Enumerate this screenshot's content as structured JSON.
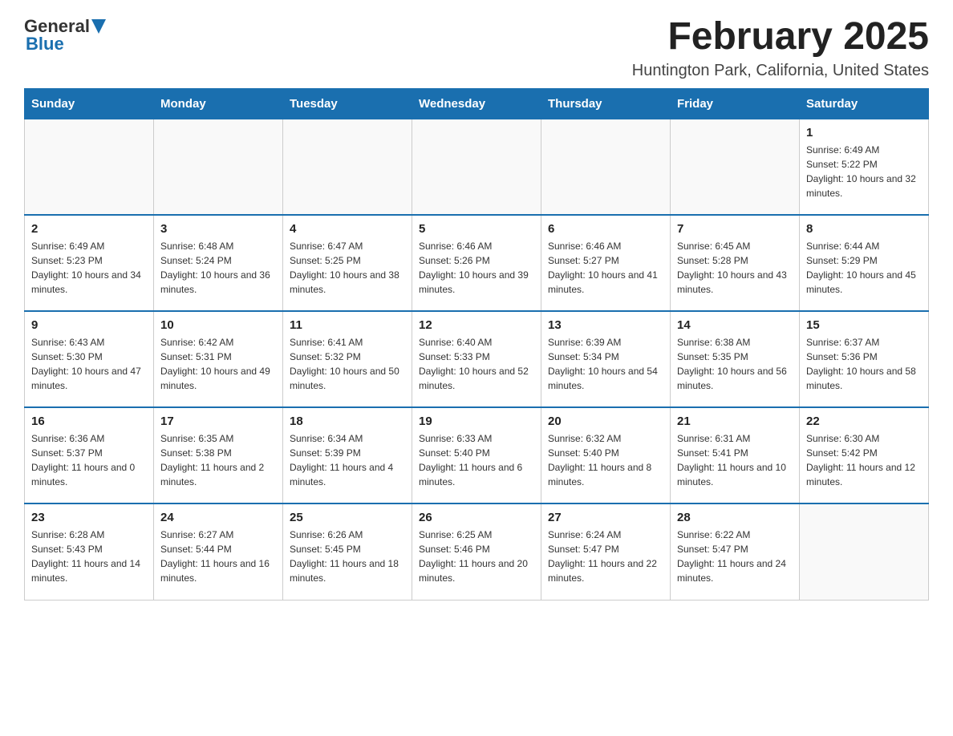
{
  "header": {
    "logo_general": "General",
    "logo_blue": "Blue",
    "month_title": "February 2025",
    "location": "Huntington Park, California, United States"
  },
  "days_of_week": [
    "Sunday",
    "Monday",
    "Tuesday",
    "Wednesday",
    "Thursday",
    "Friday",
    "Saturday"
  ],
  "weeks": [
    [
      {
        "day": "",
        "info": ""
      },
      {
        "day": "",
        "info": ""
      },
      {
        "day": "",
        "info": ""
      },
      {
        "day": "",
        "info": ""
      },
      {
        "day": "",
        "info": ""
      },
      {
        "day": "",
        "info": ""
      },
      {
        "day": "1",
        "info": "Sunrise: 6:49 AM\nSunset: 5:22 PM\nDaylight: 10 hours and 32 minutes."
      }
    ],
    [
      {
        "day": "2",
        "info": "Sunrise: 6:49 AM\nSunset: 5:23 PM\nDaylight: 10 hours and 34 minutes."
      },
      {
        "day": "3",
        "info": "Sunrise: 6:48 AM\nSunset: 5:24 PM\nDaylight: 10 hours and 36 minutes."
      },
      {
        "day": "4",
        "info": "Sunrise: 6:47 AM\nSunset: 5:25 PM\nDaylight: 10 hours and 38 minutes."
      },
      {
        "day": "5",
        "info": "Sunrise: 6:46 AM\nSunset: 5:26 PM\nDaylight: 10 hours and 39 minutes."
      },
      {
        "day": "6",
        "info": "Sunrise: 6:46 AM\nSunset: 5:27 PM\nDaylight: 10 hours and 41 minutes."
      },
      {
        "day": "7",
        "info": "Sunrise: 6:45 AM\nSunset: 5:28 PM\nDaylight: 10 hours and 43 minutes."
      },
      {
        "day": "8",
        "info": "Sunrise: 6:44 AM\nSunset: 5:29 PM\nDaylight: 10 hours and 45 minutes."
      }
    ],
    [
      {
        "day": "9",
        "info": "Sunrise: 6:43 AM\nSunset: 5:30 PM\nDaylight: 10 hours and 47 minutes."
      },
      {
        "day": "10",
        "info": "Sunrise: 6:42 AM\nSunset: 5:31 PM\nDaylight: 10 hours and 49 minutes."
      },
      {
        "day": "11",
        "info": "Sunrise: 6:41 AM\nSunset: 5:32 PM\nDaylight: 10 hours and 50 minutes."
      },
      {
        "day": "12",
        "info": "Sunrise: 6:40 AM\nSunset: 5:33 PM\nDaylight: 10 hours and 52 minutes."
      },
      {
        "day": "13",
        "info": "Sunrise: 6:39 AM\nSunset: 5:34 PM\nDaylight: 10 hours and 54 minutes."
      },
      {
        "day": "14",
        "info": "Sunrise: 6:38 AM\nSunset: 5:35 PM\nDaylight: 10 hours and 56 minutes."
      },
      {
        "day": "15",
        "info": "Sunrise: 6:37 AM\nSunset: 5:36 PM\nDaylight: 10 hours and 58 minutes."
      }
    ],
    [
      {
        "day": "16",
        "info": "Sunrise: 6:36 AM\nSunset: 5:37 PM\nDaylight: 11 hours and 0 minutes."
      },
      {
        "day": "17",
        "info": "Sunrise: 6:35 AM\nSunset: 5:38 PM\nDaylight: 11 hours and 2 minutes."
      },
      {
        "day": "18",
        "info": "Sunrise: 6:34 AM\nSunset: 5:39 PM\nDaylight: 11 hours and 4 minutes."
      },
      {
        "day": "19",
        "info": "Sunrise: 6:33 AM\nSunset: 5:40 PM\nDaylight: 11 hours and 6 minutes."
      },
      {
        "day": "20",
        "info": "Sunrise: 6:32 AM\nSunset: 5:40 PM\nDaylight: 11 hours and 8 minutes."
      },
      {
        "day": "21",
        "info": "Sunrise: 6:31 AM\nSunset: 5:41 PM\nDaylight: 11 hours and 10 minutes."
      },
      {
        "day": "22",
        "info": "Sunrise: 6:30 AM\nSunset: 5:42 PM\nDaylight: 11 hours and 12 minutes."
      }
    ],
    [
      {
        "day": "23",
        "info": "Sunrise: 6:28 AM\nSunset: 5:43 PM\nDaylight: 11 hours and 14 minutes."
      },
      {
        "day": "24",
        "info": "Sunrise: 6:27 AM\nSunset: 5:44 PM\nDaylight: 11 hours and 16 minutes."
      },
      {
        "day": "25",
        "info": "Sunrise: 6:26 AM\nSunset: 5:45 PM\nDaylight: 11 hours and 18 minutes."
      },
      {
        "day": "26",
        "info": "Sunrise: 6:25 AM\nSunset: 5:46 PM\nDaylight: 11 hours and 20 minutes."
      },
      {
        "day": "27",
        "info": "Sunrise: 6:24 AM\nSunset: 5:47 PM\nDaylight: 11 hours and 22 minutes."
      },
      {
        "day": "28",
        "info": "Sunrise: 6:22 AM\nSunset: 5:47 PM\nDaylight: 11 hours and 24 minutes."
      },
      {
        "day": "",
        "info": ""
      }
    ]
  ]
}
